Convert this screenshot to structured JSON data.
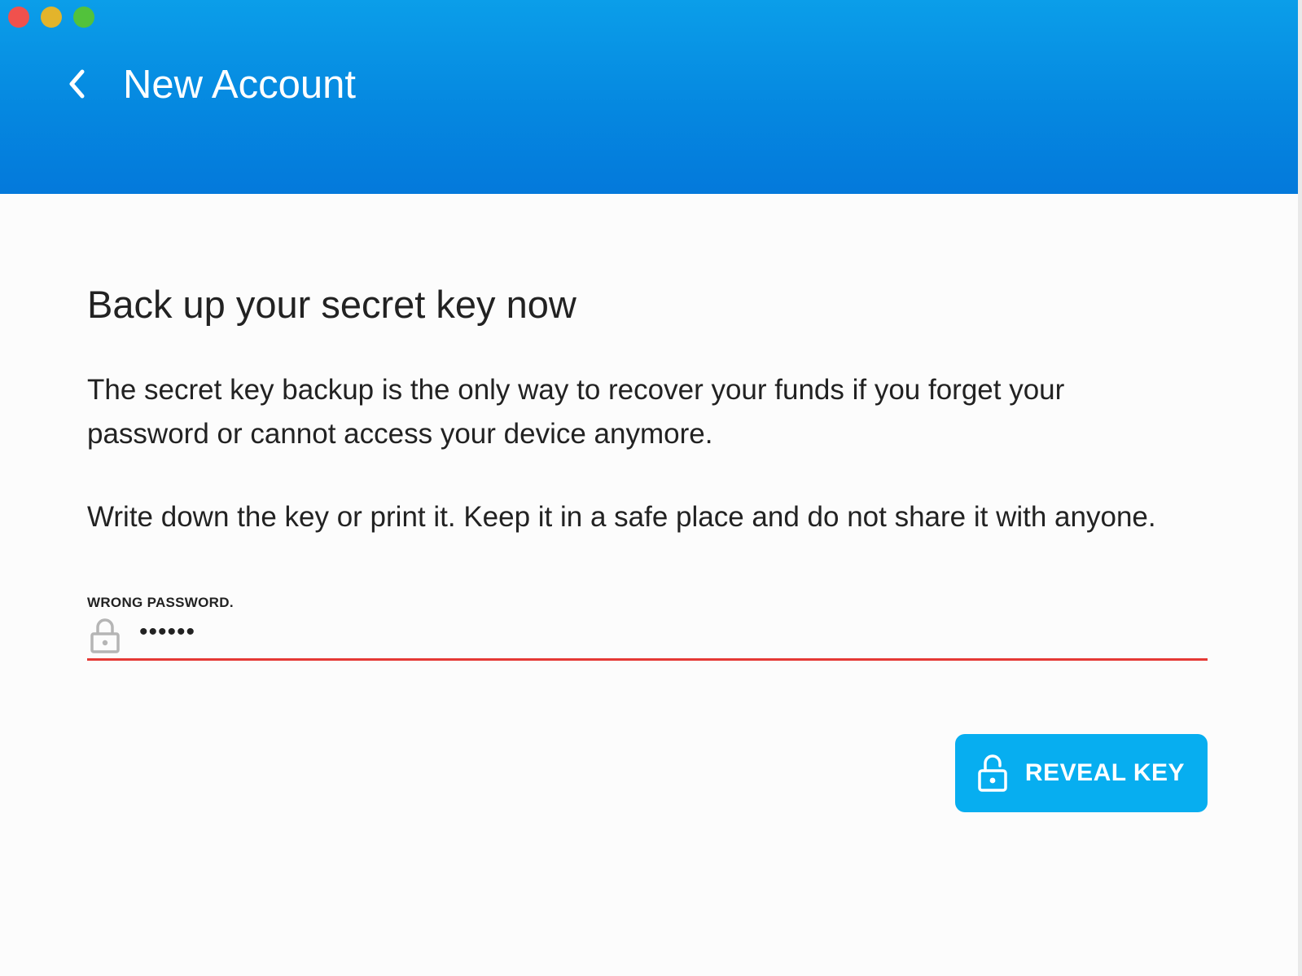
{
  "window": {
    "controls": [
      "close",
      "minimize",
      "zoom"
    ]
  },
  "header": {
    "title": "New Account",
    "back_icon": "chevron-left-icon",
    "background_color": "#0588e0"
  },
  "main": {
    "heading": "Back up your secret key now",
    "paragraph_1_line_1": "The secret key backup is the only way to recover your funds if you forget your",
    "paragraph_1_line_2": "password or cannot access your device anymore.",
    "paragraph_2": "Write down the key or print it. Keep it in a safe place and do not share it with anyone."
  },
  "password_field": {
    "error_label": "WRONG PASSWORD.",
    "value": "••••••",
    "icon": "lock-icon",
    "error_color": "#e53935"
  },
  "reveal_button": {
    "label": "REVEAL KEY",
    "icon": "unlock-icon",
    "color": "#07aef0"
  }
}
